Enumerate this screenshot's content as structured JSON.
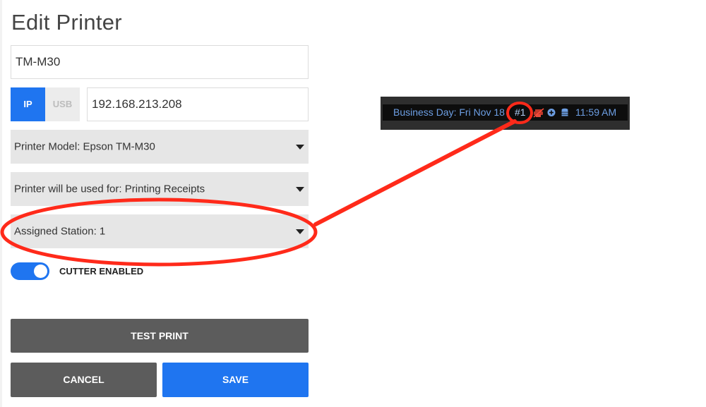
{
  "dialog": {
    "title": "Edit Printer",
    "printer_name": "TM-M30",
    "connection": {
      "ip_label": "IP",
      "usb_label": "USB",
      "selected": "IP"
    },
    "ip_address": "192.168.213.208",
    "model_select": "Printer Model: Epson TM-M30",
    "usage_select": "Printer will be used for: Printing Receipts",
    "station_select": "Assigned Station: 1",
    "cutter": {
      "label": "CUTTER ENABLED",
      "enabled": true
    },
    "buttons": {
      "test_print": "TEST PRINT",
      "cancel": "CANCEL",
      "save": "SAVE"
    }
  },
  "status_bar": {
    "business_day": "Business Day: Fri Nov 18",
    "station_number": "#1",
    "icons": [
      "printer-error-icon",
      "add-circle-icon",
      "database-icon"
    ],
    "time": "11:59 AM"
  },
  "annotation": {
    "color": "#ff2a1a"
  },
  "colors": {
    "accent": "#1f75f0",
    "dark_button": "#5c5c5c",
    "select_bg": "#e6e6e6"
  }
}
